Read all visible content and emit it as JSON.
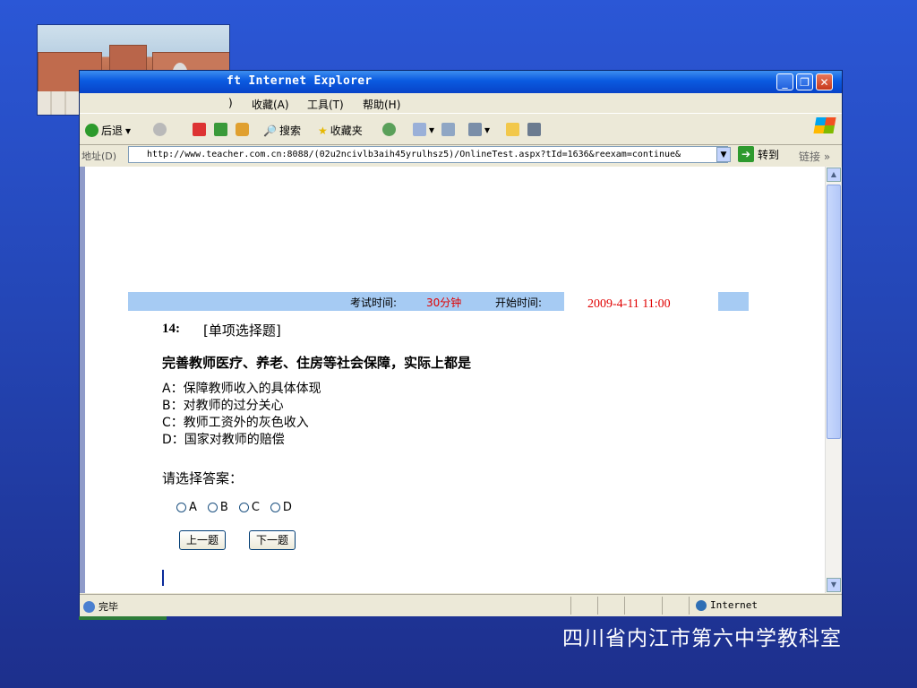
{
  "browser": {
    "title": "ft Internet Explorer",
    "menu": [
      "收藏(A)",
      "工具(T)",
      "帮助(H)"
    ],
    "menu_partial": ")",
    "toolbar": {
      "back": "后退",
      "search": "搜索",
      "favorites": "收藏夹"
    },
    "address": {
      "label": "地址(D)",
      "url": "http://www.teacher.com.cn:8088/(02u2ncivlb3aih45yrulhsz5)/OnlineTest.aspx?tId=1636&reexam=continue&",
      "go": "转到",
      "links": "链接 »"
    },
    "status": {
      "done": "完毕",
      "zone": "Internet"
    }
  },
  "exam": {
    "time_label": "考试时间:",
    "time_value": "30分钟",
    "start_label": "开始时间:",
    "start_value": "2009-4-11   11:00",
    "question_number": "14:",
    "question_type": "[单项选择题]",
    "question_text": "完善教师医疗、养老、住房等社会保障，实际上都是",
    "options": [
      "A：保障教师收入的具体体现",
      "B：对教师的过分关心",
      "C：教师工资外的灰色收入",
      "D：国家对教师的赔偿"
    ],
    "prompt": "请选择答案：",
    "radio_labels": [
      "A",
      "B",
      "C",
      "D"
    ],
    "prev_button": "上一题",
    "next_button": "下一题"
  },
  "footer": "四川省内江市第六中学教科室",
  "colors": {
    "accent_red": "#e00000",
    "info_bar": "#a6cbf3",
    "background": "#2446b6"
  }
}
